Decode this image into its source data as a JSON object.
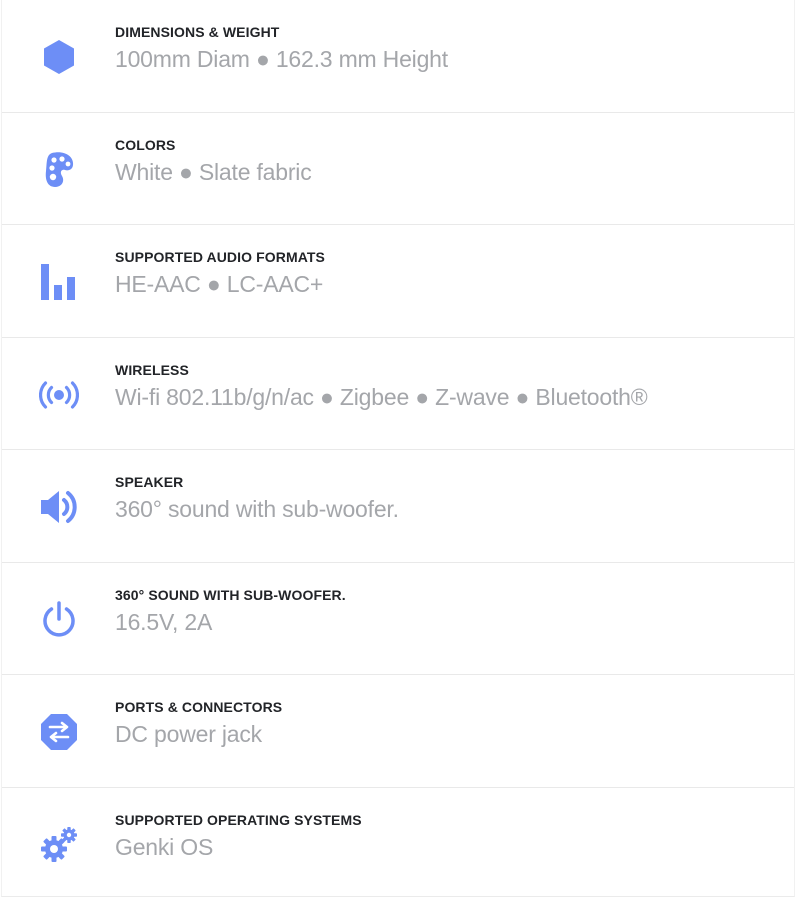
{
  "accent_color": "#6d8ef6",
  "specs": [
    {
      "icon": "hexagon-icon",
      "title": "DIMENSIONS & WEIGHT",
      "value": "100mm Diam ● 162.3 mm Height"
    },
    {
      "icon": "palette-icon",
      "title": "COLORS",
      "value": "White ● Slate fabric"
    },
    {
      "icon": "bar-chart-icon",
      "title": "SUPPORTED AUDIO FORMATS",
      "value": "HE-AAC ● LC-AAC+"
    },
    {
      "icon": "wireless-signal-icon",
      "title": "WIRELESS",
      "value": "Wi-fi 802.11b/g/n/ac ● Zigbee ● Z-wave ● Bluetooth®"
    },
    {
      "icon": "speaker-volume-icon",
      "title": "SPEAKER",
      "value": "360° sound with sub-woofer."
    },
    {
      "icon": "power-icon",
      "title": "360° SOUND WITH SUB-WOOFER.",
      "value": "16.5V, 2A"
    },
    {
      "icon": "exchange-arrows-icon",
      "title": "PORTS & CONNECTORS",
      "value": "DC power jack"
    },
    {
      "icon": "gears-icon",
      "title": "SUPPORTED OPERATING SYSTEMS",
      "value": "Genki OS"
    }
  ]
}
